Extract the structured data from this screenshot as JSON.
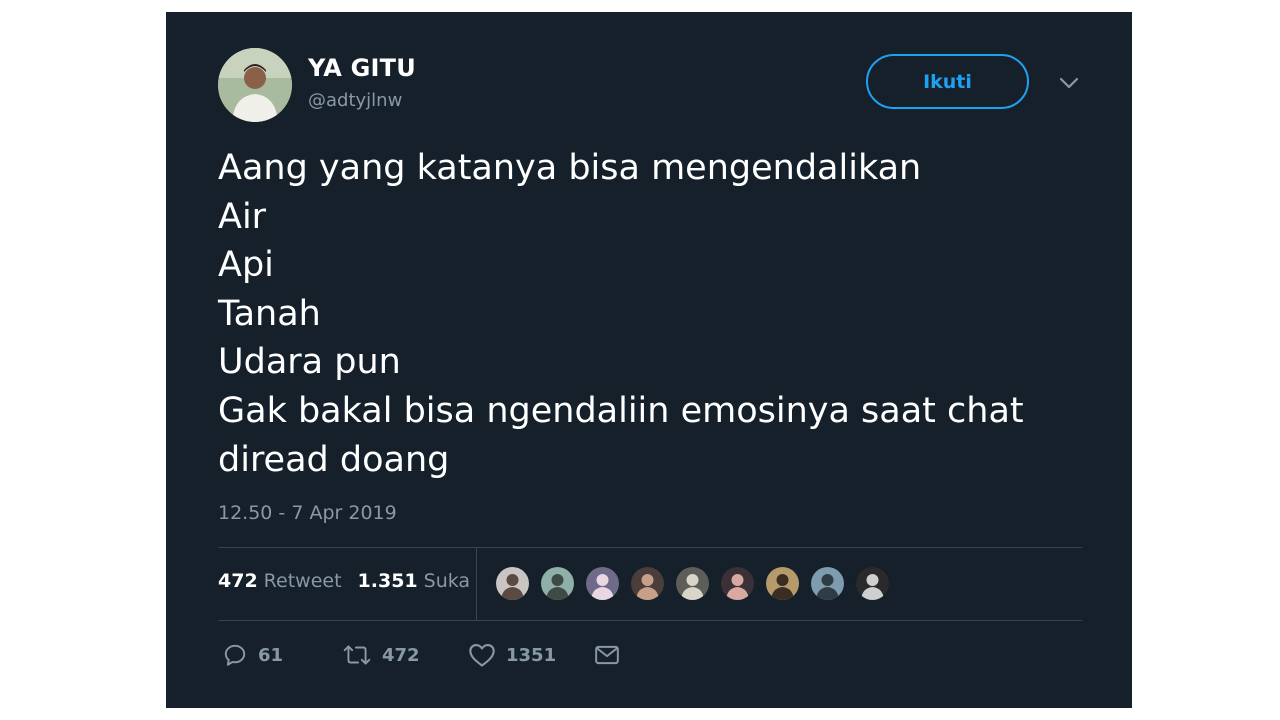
{
  "tweet": {
    "display_name": "YA GITU",
    "handle": "@adtyjlnw",
    "follow_label": "Ikuti",
    "text_lines": [
      "Aang yang katanya bisa mengendalikan",
      "Air",
      "Api",
      "Tanah",
      "Udara pun",
      "Gak bakal bisa ngendaliin emosinya saat chat",
      "diread doang"
    ],
    "timestamp": "12.50 - 7 Apr 2019",
    "stats": {
      "retweets_count": "472",
      "retweets_label": "Retweet",
      "likes_count": "1.351",
      "likes_label": "Suka"
    },
    "actions": {
      "reply_count": "61",
      "retweet_count": "472",
      "like_count": "1351"
    }
  },
  "icons": {
    "avatar": "profile-photo",
    "caret": "chevron-down-icon",
    "reply": "reply-icon",
    "retweet": "retweet-icon",
    "like": "heart-icon",
    "message": "envelope-icon"
  },
  "colors": {
    "background": "#15202b",
    "accent": "#1da1f2",
    "secondary_text": "#8899a6",
    "divider": "#38444d"
  },
  "liker_avatars": [
    {
      "bg": "#c9c5c2",
      "fg": "#5a4a42"
    },
    {
      "bg": "#8fb0a8",
      "fg": "#3e4a46"
    },
    {
      "bg": "#6f6a8a",
      "fg": "#e9d8e2"
    },
    {
      "bg": "#4b3e3a",
      "fg": "#c7a08a"
    },
    {
      "bg": "#5e5e58",
      "fg": "#dad5c9"
    },
    {
      "bg": "#3a3036",
      "fg": "#d9a8a0"
    },
    {
      "bg": "#b59b6c",
      "fg": "#3b2d22"
    },
    {
      "bg": "#7d9cb0",
      "fg": "#2f3c46"
    },
    {
      "bg": "#2a2a2a",
      "fg": "#cfcfcf"
    }
  ]
}
